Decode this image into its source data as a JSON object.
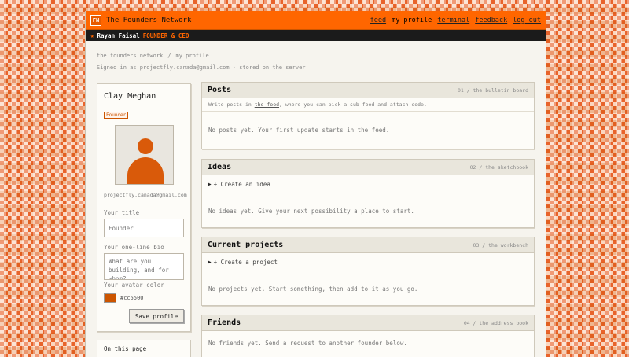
{
  "header": {
    "logo_text": "FN",
    "brand": "The Founders Network",
    "nav": {
      "feed": "feed",
      "my_profile": "my profile",
      "terminal": "terminal",
      "feedback": "feedback",
      "logout": "log out"
    }
  },
  "userbar": {
    "star": "★",
    "name": "Rayan Faisal",
    "role": "FOUNDER & CEO"
  },
  "breadcrumb": {
    "root": "the founders network",
    "sep": "/",
    "current": "my profile"
  },
  "signed_in": "Signed in as projectfly.canada@gmail.com · stored on the server",
  "profile": {
    "name": "Clay Meghan",
    "badge": "Founder",
    "email": "projectfly.canada@gmail.com",
    "title_label": "Your title",
    "title_placeholder": "Founder",
    "bio_label": "Your one-line bio",
    "bio_placeholder": "What are you building, and for whom?",
    "avatar_color_label": "Your avatar color",
    "avatar_color": "#cc5500",
    "avatar_color_text": "#cc5500",
    "save_label": "Save profile"
  },
  "on_this_page": "On this page",
  "panels": {
    "posts": {
      "title": "Posts",
      "tag": "01 / the bulletin board",
      "hint_before": "Write posts in ",
      "hint_link": "the feed",
      "hint_after": ", where you can pick a sub-feed and attach code.",
      "empty": "No posts yet. Your first update starts in the feed."
    },
    "ideas": {
      "title": "Ideas",
      "tag": "02 / the sketchbook",
      "create": "+ Create an idea",
      "empty": "No ideas yet. Give your next possibility a place to start."
    },
    "projects": {
      "title": "Current projects",
      "tag": "03 / the workbench",
      "create": "+ Create a project",
      "empty": "No projects yet. Start something, then add to it as you go."
    },
    "friends": {
      "title": "Friends",
      "tag": "04 / the address book",
      "empty": "No friends yet. Send a request to another founder below."
    }
  },
  "colors": {
    "accent": "#ff6600",
    "accent_dark": "#cc5500",
    "userbar_bg": "#1b1b1b"
  }
}
